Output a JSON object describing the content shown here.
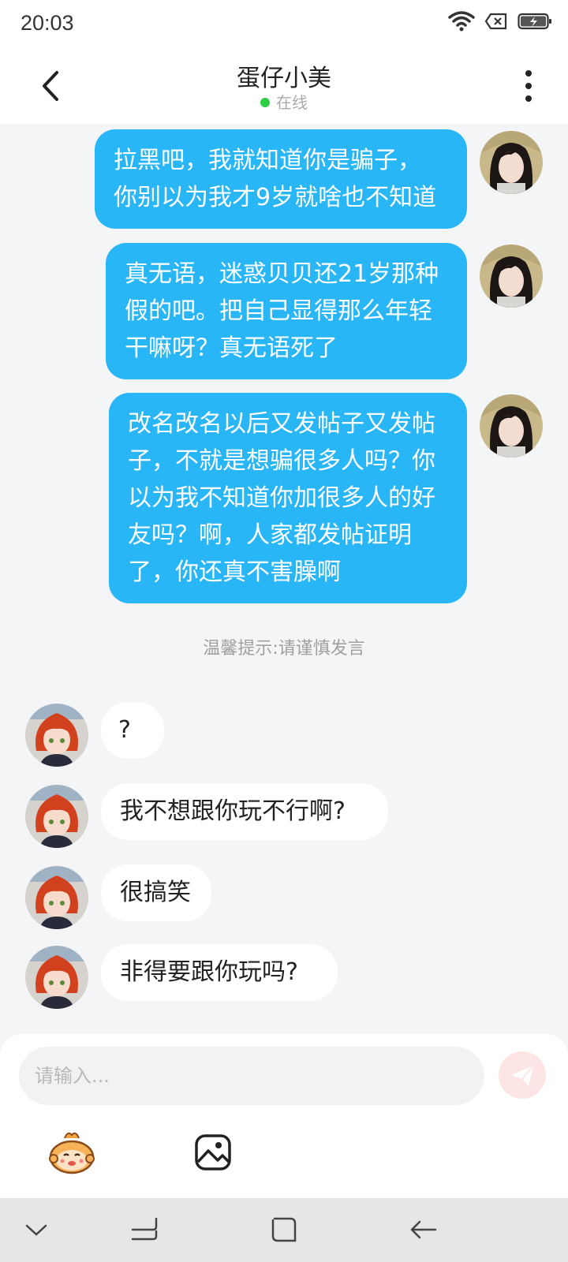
{
  "status_bar": {
    "time": "20:03"
  },
  "header": {
    "title": "蛋仔小美",
    "presence": "在线",
    "presence_color": "#2ecc40"
  },
  "messages": [
    {
      "side": "me",
      "text": "拉黑吧，我就知道你是骗子，\n你别以为我才9岁就啥也不知道"
    },
    {
      "side": "me",
      "text": "真无语，迷惑贝贝还21岁那种\n假的吧。把自己显得那么年轻\n干嘛呀？真无语死了"
    },
    {
      "side": "me",
      "text": "改名改名以后又发帖子又发帖\n子，不就是想骗很多人吗？你\n以为我不知道你加很多人的好\n友吗？啊，人家都发帖证明\n了，你还真不害臊啊"
    },
    {
      "side": "other",
      "text": "?"
    },
    {
      "side": "other",
      "text": "我不想跟你玩不行啊?"
    },
    {
      "side": "other",
      "text": "很搞笑"
    },
    {
      "side": "other",
      "text": "非得要跟你玩吗?"
    }
  ],
  "tip": "温馨提示:请谨慎发言",
  "input": {
    "placeholder": "请输入..."
  },
  "colors": {
    "my_bubble": "#29b6f6",
    "their_bubble": "#ffffff",
    "background": "#f4f5f7"
  },
  "icons": {
    "back": "chevron-left-icon",
    "more": "more-vertical-icon",
    "send": "send-plane-icon",
    "emoji": "eggy-mascot-icon",
    "image": "image-icon"
  }
}
